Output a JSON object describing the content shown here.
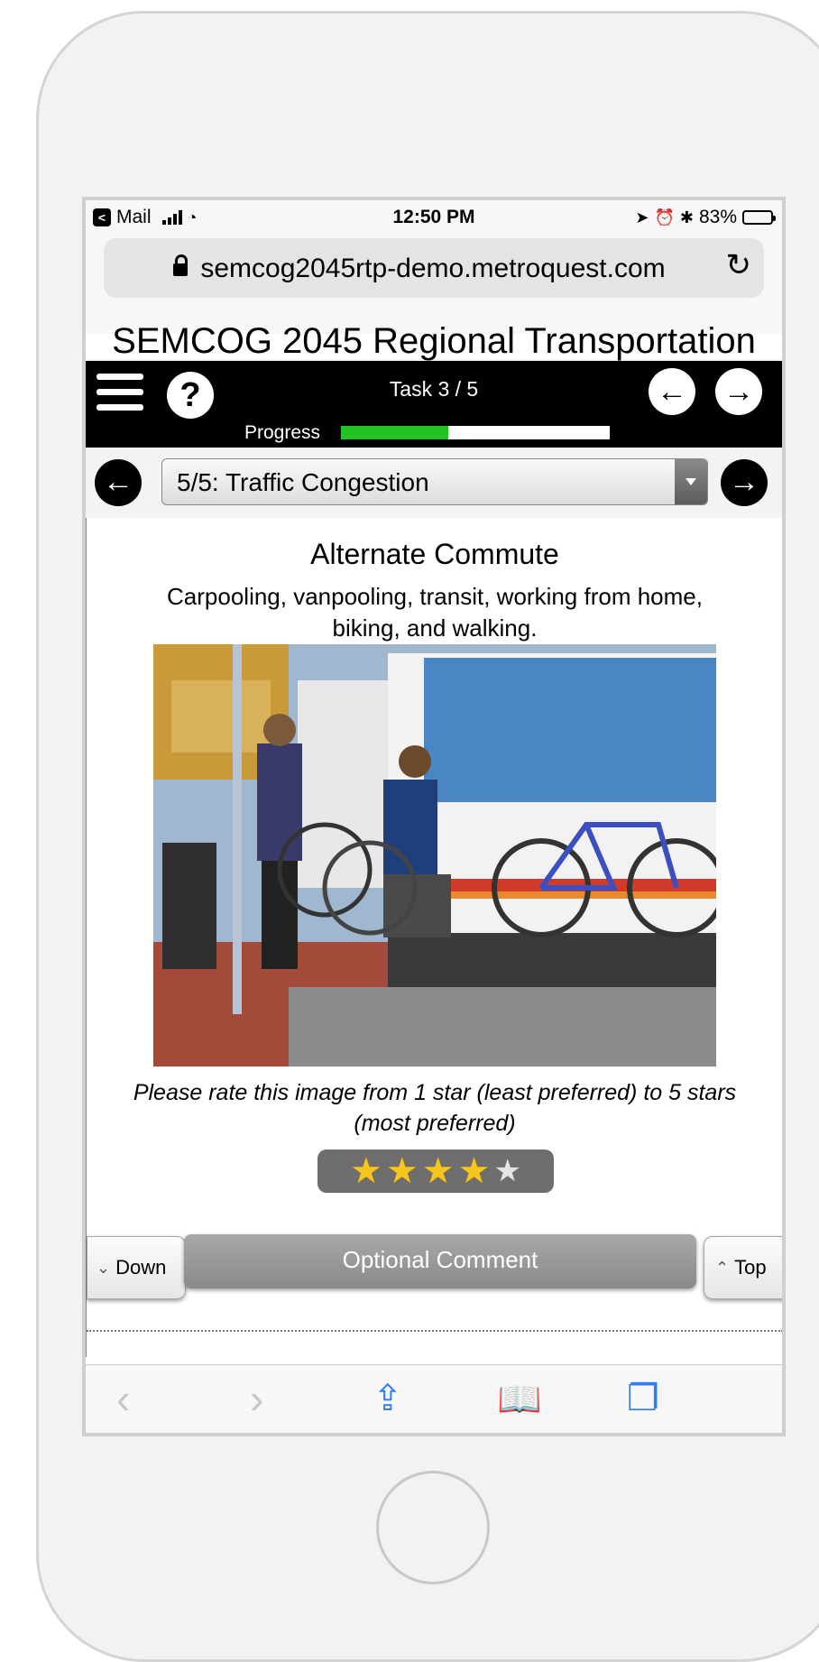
{
  "status_bar": {
    "carrier": "Mail",
    "time": "12:50 PM",
    "battery": "83%",
    "battery_level": 0.83
  },
  "browser": {
    "url": "semcog2045rtp-demo.metroquest.com"
  },
  "app": {
    "title": "SEMCOG 2045 Regional Transportation"
  },
  "nav": {
    "task_label": "Task 3 / 5",
    "progress_label": "Progress",
    "progress_fraction": 0.4
  },
  "selector": {
    "selected": "5/5: Traffic Congestion"
  },
  "card": {
    "title": "Alternate Commute",
    "description": "Carpooling, vanpooling, transit, working from home, biking, and walking.",
    "image_alt": "People loading bicycles onto a bus bike rack",
    "rate_prompt": "Please rate this image from 1 star (least preferred) to 5 stars (most preferred)",
    "rating": 4,
    "rating_max": 5
  },
  "buttons": {
    "down": "Down",
    "comment": "Optional Comment",
    "top": "Top"
  },
  "colors": {
    "progress": "#22c322",
    "star": "#f6c520",
    "toolbar_icon": "#2f7cf6"
  }
}
